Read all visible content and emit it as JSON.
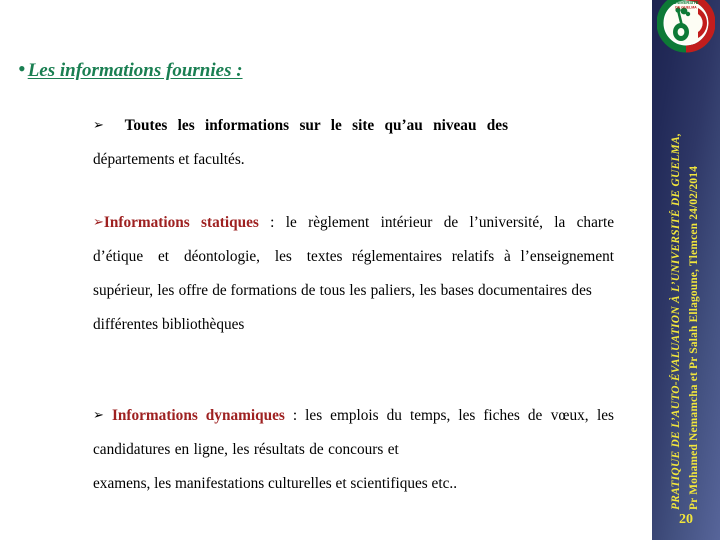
{
  "slide": {
    "page_number": "20",
    "heading": {
      "bullet": "•",
      "text": "Les informations fournies :",
      "color": "#1a7f52"
    },
    "accent_colors": {
      "heading_green": "#1a7f52",
      "lead_red": "#9e2121",
      "sidebar_text_yellow": "#f2e63c",
      "sidebar_blue_dark": "#1d2450",
      "sidebar_blue_light": "#57659a"
    },
    "blocks": [
      {
        "marker": "➢",
        "marker_color": "#000000",
        "lead": "",
        "lead_color": "#000000",
        "line1": "Toutes les informations sur le site qu’au niveau des",
        "line2": "départements et facultés."
      },
      {
        "marker": "➢",
        "marker_color": "#9e2121",
        "lead": "Informations statiques",
        "lead_color": "#9e2121",
        "line1_rest": " : le règlement intérieur de",
        "line2": "l’université, la charte d’étique et déontologie, les textes",
        "line3": "réglementaires relatifs à l’enseignement supérieur, les offre de",
        "line4": "formations de tous les paliers, les bases documentaires des",
        "line5": "différentes bibliothèques"
      },
      {
        "marker": "➢",
        "marker_color": "#000000",
        "lead": "Informations dynamiques",
        "lead_color": "#9e2121",
        "line1_rest": " : les emplois du temps, les fiches",
        "line2": "de vœux, les candidatures en ligne, les résultats de concours et",
        "line3": "examens, les manifestations culturelles et scientifiques etc.."
      }
    ],
    "sidebar": {
      "logo_name": "university-emblem-logo",
      "title_line": "PRATIQUE DE L’AUTO-ÉVALUATION À L’UNIVERSITÉ DE GUELMA,",
      "authors_line": "Pr Mohamed Nemamcha et Pr Salah Ellagoune, Tlemcen 24/02/2014"
    }
  }
}
